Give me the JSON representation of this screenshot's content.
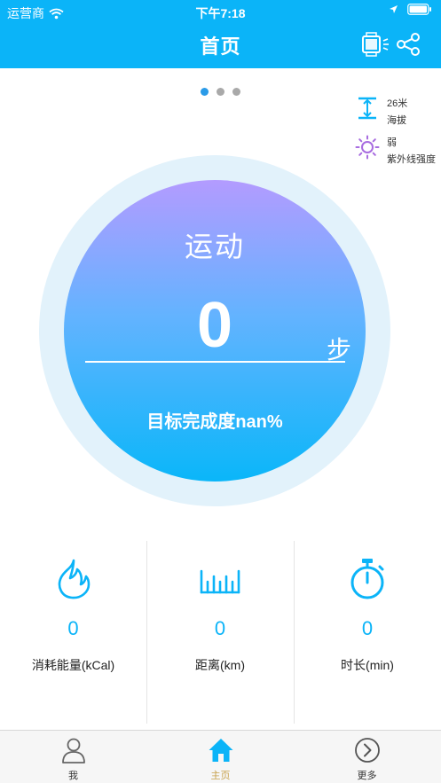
{
  "status_bar": {
    "carrier": "运营商",
    "time": "下午7:18"
  },
  "nav": {
    "title": "首页",
    "watch_icon": "watch-battery-icon",
    "share_icon": "share-icon"
  },
  "pager": {
    "count": 3,
    "active": 0
  },
  "env": {
    "altitude": {
      "value": "26米",
      "label": "海拔",
      "icon": "altitude-icon"
    },
    "uv": {
      "value": "弱",
      "label": "紫外线强度",
      "icon": "sun-icon"
    }
  },
  "activity": {
    "title": "运动",
    "steps": "0",
    "unit": "步",
    "goal": "目标完成度nan%"
  },
  "stats": [
    {
      "icon": "flame-icon",
      "value": "0",
      "label": "消耗能量(kCal)"
    },
    {
      "icon": "ruler-icon",
      "value": "0",
      "label": "距离(km)"
    },
    {
      "icon": "stopwatch-icon",
      "value": "0",
      "label": "时长(min)"
    }
  ],
  "tabs": [
    {
      "label": "我",
      "icon": "user-icon"
    },
    {
      "label": "主页",
      "icon": "home-icon"
    },
    {
      "label": "更多",
      "icon": "more-arrow-icon"
    }
  ],
  "colors": {
    "primary": "#0bb4f8",
    "ring": "#e2f2fb",
    "tab_active": "#c8a24d",
    "uv": "#a86ce0"
  }
}
